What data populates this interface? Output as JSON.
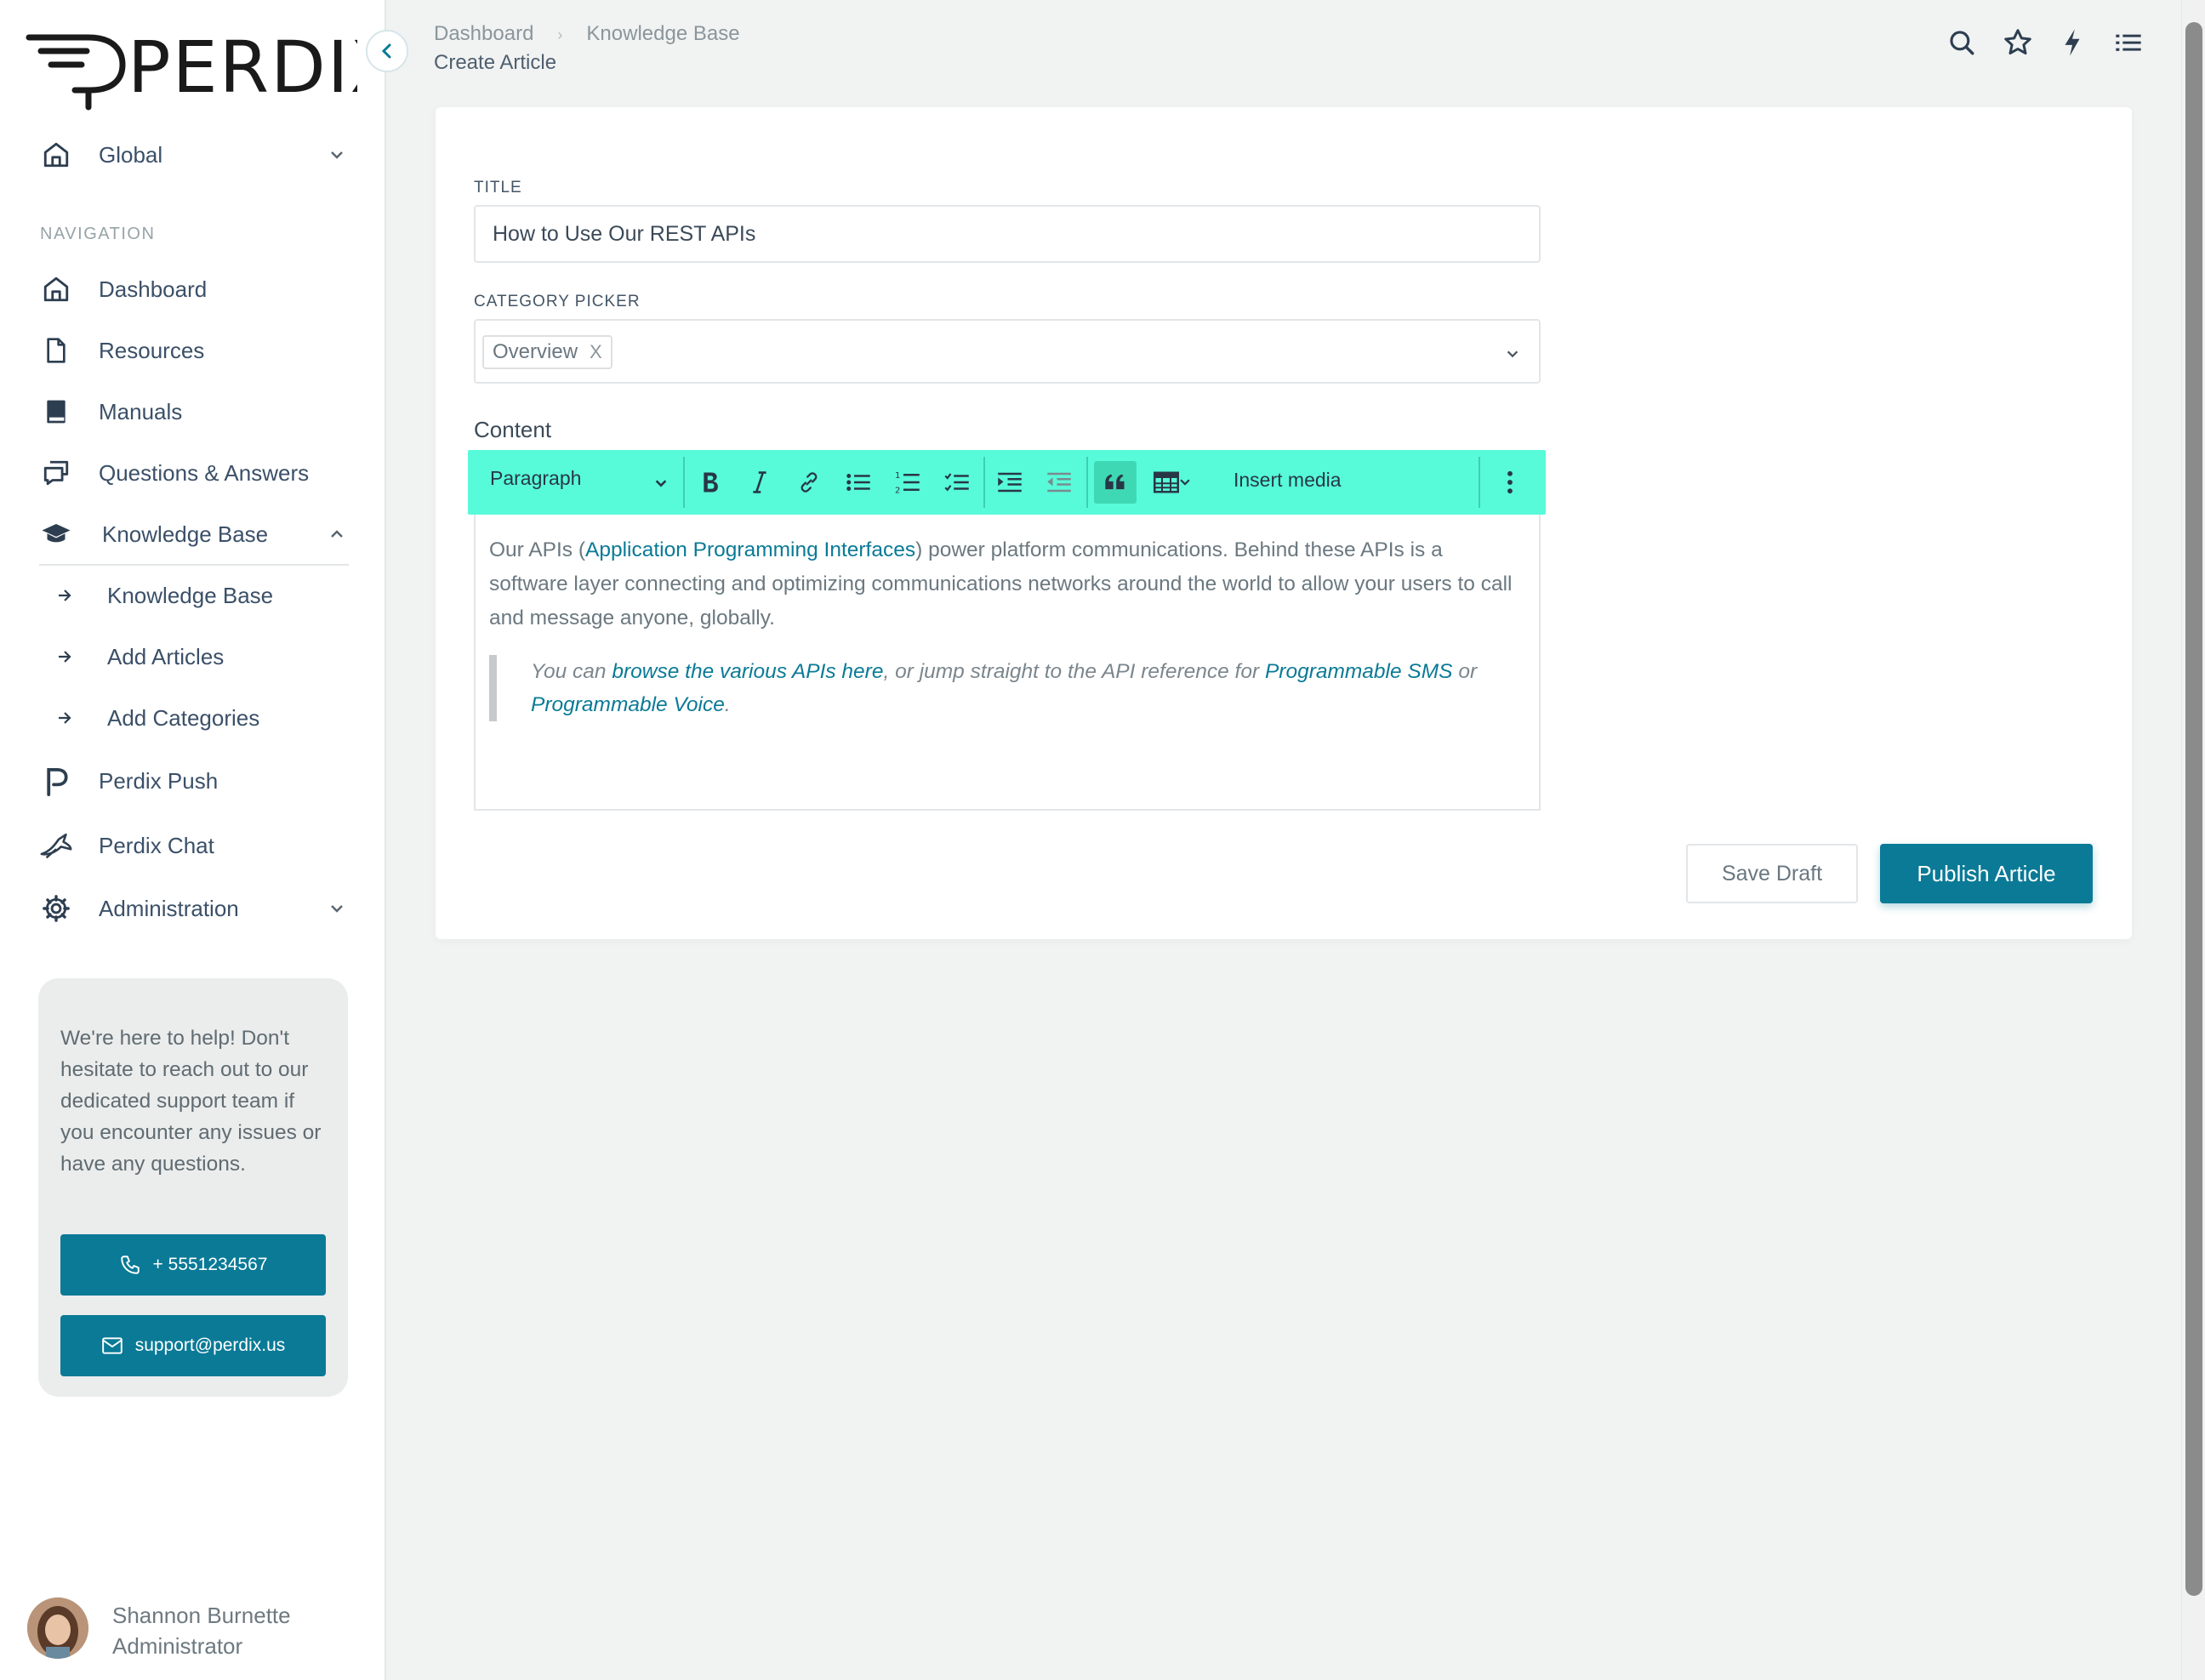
{
  "app": {
    "logo_text": "PERDIX"
  },
  "sidebar": {
    "workspace": {
      "label": "Global"
    },
    "nav_heading": "NAVIGATION",
    "items": [
      {
        "label": "Dashboard"
      },
      {
        "label": "Resources"
      },
      {
        "label": "Manuals"
      },
      {
        "label": "Questions & Answers"
      },
      {
        "label": "Knowledge Base",
        "expanded": true
      },
      {
        "label": "Perdix Push"
      },
      {
        "label": "Perdix Chat"
      },
      {
        "label": "Administration"
      }
    ],
    "kb_sub_items": [
      {
        "label": "Knowledge Base"
      },
      {
        "label": "Add Articles"
      },
      {
        "label": "Add Categories"
      }
    ],
    "help": {
      "text": "We're here to help! Don't hesitate to reach out to our dedicated support team if you encounter any issues or have any questions.",
      "phone": "+ 5551234567",
      "email": "support@perdix.us"
    },
    "user": {
      "name": "Shannon Burnette",
      "role": "Administrator"
    }
  },
  "header": {
    "breadcrumb": [
      "Dashboard",
      "Knowledge Base"
    ],
    "page_title": "Create Article",
    "icons": [
      "search-icon",
      "star-icon",
      "bolt-icon",
      "list-icon"
    ]
  },
  "form": {
    "title_label": "TITLE",
    "title_value": "How to Use Our REST APIs",
    "category_label": "CATEGORY PICKER",
    "category_tag": "Overview",
    "category_tag_remove": "X",
    "content_label": "Content",
    "toolbar": {
      "paragraph_label": "Paragraph",
      "insert_media": "Insert media",
      "highlight_color": "#57fbd9"
    },
    "editor": {
      "p1_before": "Our APIs (",
      "p1_link": "Application Programming Interfaces",
      "p1_after": ") power platform communications. Behind these APIs is a software layer connecting and optimizing communications networks around the world to allow your users to call and message anyone, globally.",
      "q_before": "You can ",
      "q_link1": "browse the various APIs here",
      "q_mid1": ", or jump straight to the API reference for ",
      "q_link2": "Programmable SMS",
      "q_mid2": " or ",
      "q_link3": "Programmable Voice",
      "q_after": "."
    },
    "save_draft": "Save Draft",
    "publish": "Publish Article"
  },
  "colors": {
    "brand": "#0a7a96",
    "background": "#f1f2f2"
  }
}
